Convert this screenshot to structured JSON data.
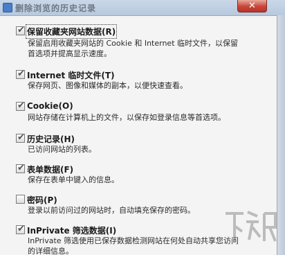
{
  "window": {
    "title": "删除浏览的历史记录",
    "close_label": "✕"
  },
  "options": [
    {
      "label": "保留收藏夹网站数据(R)",
      "description": "保留启用收藏夹网站的 Cookie 和 Internet 临时文件，以保留\n首选项并提高显示速度。",
      "checked": true
    },
    {
      "label": "Internet 临时文件(T)",
      "description": "保存网页、图像和媒体的副本，以便快速查看。",
      "checked": true
    },
    {
      "label": "Cookie(O)",
      "description": "网站存储在计算机上的文件，以保存如登录信息等首选项。",
      "checked": true
    },
    {
      "label": "历史记录(H)",
      "description": "已访问网站的列表。",
      "checked": true
    },
    {
      "label": "表单数据(F)",
      "description": "保存在表单中键入的信息。",
      "checked": true
    },
    {
      "label": "密码(P)",
      "description": "登录以前访问过的网站时，自动填充保存的密码。",
      "checked": false
    },
    {
      "label": "InPrivate 筛选数据(I)",
      "description": "InPrivate 筛选使用已保存数据检测网站在何处自动共享您访问\n的详细信息。",
      "checked": true
    }
  ],
  "icons": {
    "checkmark": "✔"
  }
}
